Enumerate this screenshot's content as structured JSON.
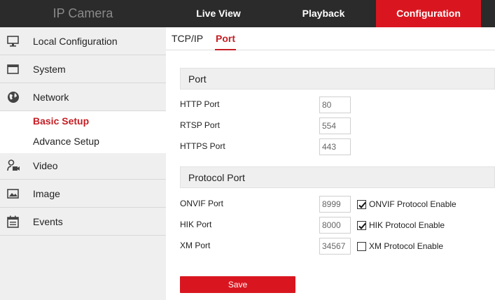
{
  "header": {
    "brand": "IP Camera",
    "tabs": [
      {
        "label": "Live View"
      },
      {
        "label": "Playback"
      },
      {
        "label": "Configuration"
      }
    ]
  },
  "sidebar": {
    "items": [
      {
        "label": "Local Configuration",
        "icon": "monitor-icon"
      },
      {
        "label": "System",
        "icon": "window-icon"
      },
      {
        "label": "Network",
        "icon": "globe-icon"
      },
      {
        "label": "Video",
        "icon": "camera-person-icon"
      },
      {
        "label": "Image",
        "icon": "image-icon"
      },
      {
        "label": "Events",
        "icon": "calendar-icon"
      }
    ],
    "network_sub": [
      {
        "label": "Basic Setup",
        "active": true
      },
      {
        "label": "Advance Setup",
        "active": false
      }
    ]
  },
  "subtabs": [
    {
      "label": "TCP/IP"
    },
    {
      "label": "Port",
      "active": true
    }
  ],
  "port_section": {
    "title": "Port",
    "fields": [
      {
        "label": "HTTP Port",
        "value": "80"
      },
      {
        "label": "RTSP Port",
        "value": "554"
      },
      {
        "label": "HTTPS Port",
        "value": "443"
      }
    ]
  },
  "protocol_section": {
    "title": "Protocol Port",
    "fields": [
      {
        "label": "ONVIF Port",
        "value": "8999",
        "check_label": "ONVIF Protocol Enable",
        "checked": true
      },
      {
        "label": "HIK Port",
        "value": "8000",
        "check_label": "HIK Protocol Enable",
        "checked": true
      },
      {
        "label": "XM Port",
        "value": "34567",
        "check_label": "XM Protocol Enable",
        "checked": false
      }
    ]
  },
  "save_label": "Save",
  "colors": {
    "accent": "#d9161f",
    "topbar": "#2b2b2b",
    "sidebar": "#efefef"
  }
}
